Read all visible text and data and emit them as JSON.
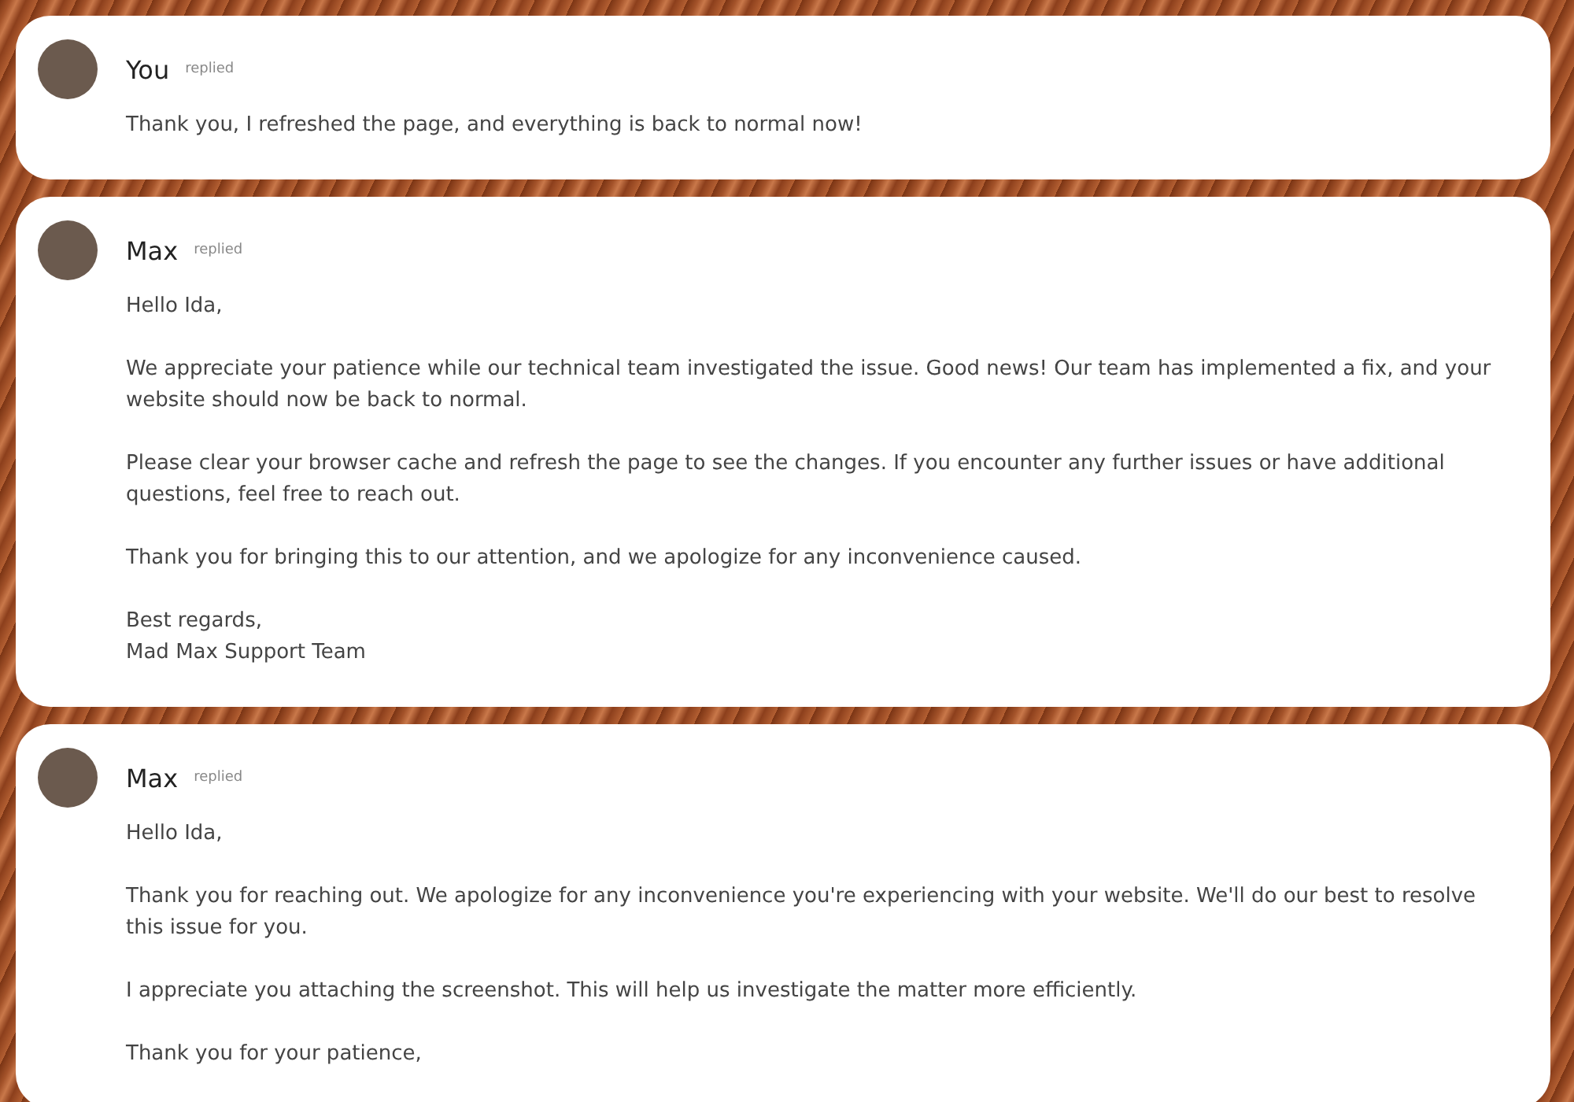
{
  "messages": [
    {
      "author": "You",
      "status": "replied",
      "paragraphs": [
        "Thank you, I refreshed the page, and everything is back to normal now!"
      ]
    },
    {
      "author": "Max",
      "status": "replied",
      "paragraphs": [
        "Hello Ida,",
        "We appreciate your patience while our technical team investigated the issue. Good news! Our team has implemented a fix, and your website should now be back to normal.",
        "Please clear your browser cache and refresh the page to see the changes. If you encounter any further issues or have additional questions, feel free to reach out.",
        "Thank you for bringing this to our attention, and we apologize for any inconvenience caused.",
        "Best regards,\nMad Max Support Team"
      ]
    },
    {
      "author": "Max",
      "status": "replied",
      "paragraphs": [
        "Hello Ida,",
        "Thank you for reaching out. We apologize for any inconvenience you're experiencing with your website. We'll do our best to resolve this issue for you.",
        "I appreciate you attaching the screenshot. This will help us investigate the matter more efficiently.",
        "Thank you for your patience,"
      ]
    }
  ]
}
